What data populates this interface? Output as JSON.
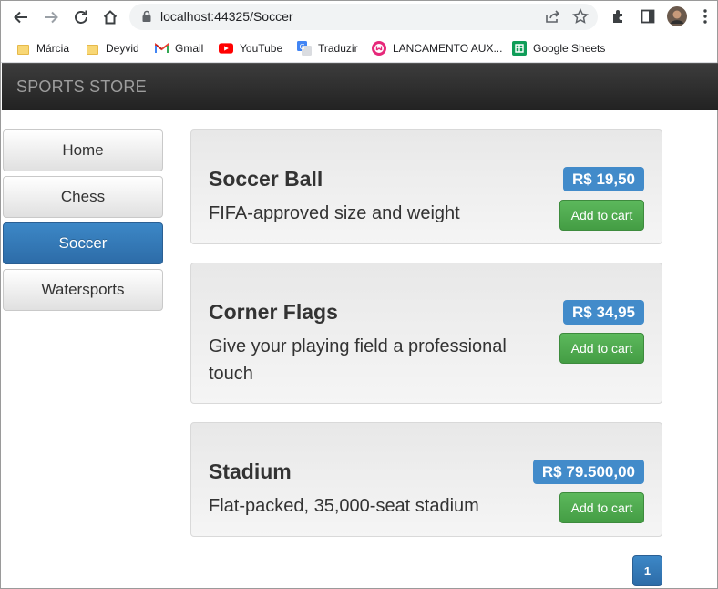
{
  "browser": {
    "url": "localhost:44325/Soccer",
    "bookmarks": [
      {
        "label": "Márcia",
        "icon": "folder-icon"
      },
      {
        "label": "Deyvid",
        "icon": "folder-icon"
      },
      {
        "label": "Gmail",
        "icon": "gmail-icon"
      },
      {
        "label": "YouTube",
        "icon": "youtube-icon"
      },
      {
        "label": "Traduzir",
        "icon": "translate-icon"
      },
      {
        "label": "LANCAMENTO AUX...",
        "icon": "app-icon"
      },
      {
        "label": "Google Sheets",
        "icon": "sheets-icon"
      }
    ]
  },
  "site": {
    "brand": "SPORTS STORE"
  },
  "categories": [
    {
      "label": "Home",
      "active": false
    },
    {
      "label": "Chess",
      "active": false
    },
    {
      "label": "Soccer",
      "active": true
    },
    {
      "label": "Watersports",
      "active": false
    }
  ],
  "products": [
    {
      "name": "Soccer Ball",
      "price": "R$ 19,50",
      "description": "FIFA-approved size and weight",
      "cart_label": "Add to cart"
    },
    {
      "name": "Corner Flags",
      "price": "R$ 34,95",
      "description": "Give your playing field a professional touch",
      "cart_label": "Add to cart"
    },
    {
      "name": "Stadium",
      "price": "R$ 79.500,00",
      "description": "Flat-packed, 35,000-seat stadium",
      "cart_label": "Add to cart"
    }
  ],
  "pagination": {
    "current_page": "1"
  },
  "colors": {
    "primary": "#428bca",
    "success": "#5cb85c",
    "navbar": "#222222"
  }
}
